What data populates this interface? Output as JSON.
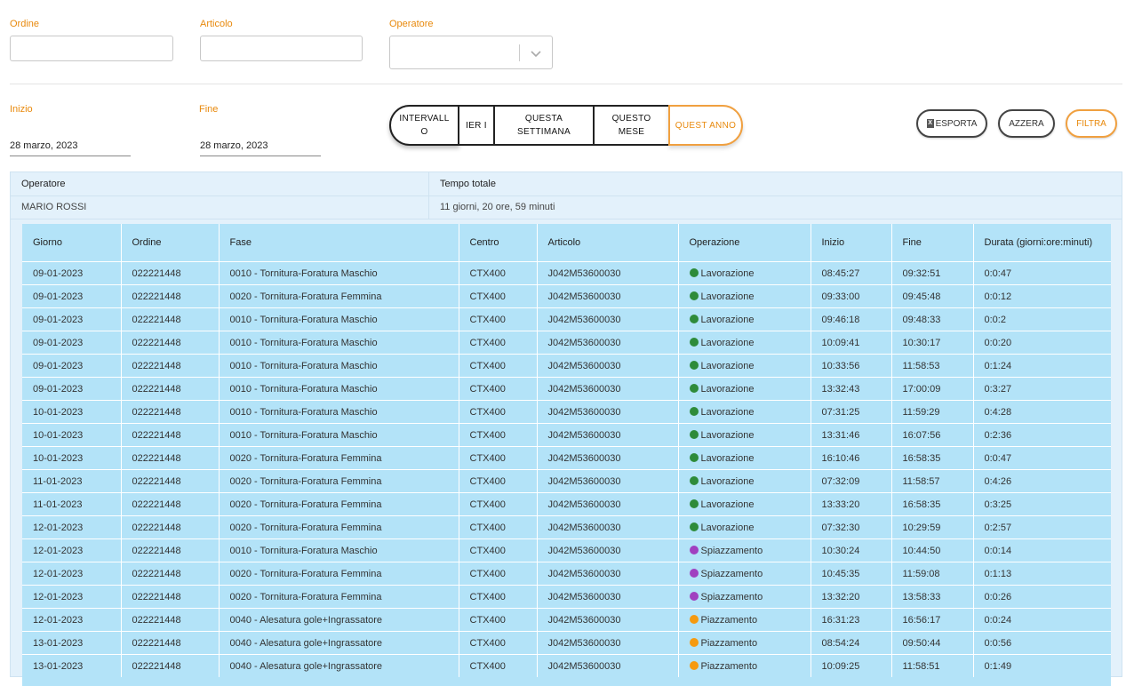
{
  "filters": {
    "ordine_label": "Ordine",
    "articolo_label": "Articolo",
    "operatore_label": "Operatore",
    "inizio_label": "Inizio",
    "inizio_value": "28 marzo, 2023",
    "fine_label": "Fine",
    "fine_value": "28 marzo, 2023"
  },
  "segments": [
    "INTERVALL O",
    "IER I",
    "QUESTA SETTIMANA",
    "QUESTO MESE",
    "QUEST ANNO"
  ],
  "actions": {
    "esporta": "ESPORTA",
    "azzera": "AZZERA",
    "filtra": "FILTRA"
  },
  "summary": {
    "col_operatore": "Operatore",
    "col_tempo": "Tempo totale",
    "operatore": "MARIO ROSSI",
    "tempo": "11 giorni, 20 ore, 59 minuti"
  },
  "colors": {
    "Lavorazione": "#2e8b3a",
    "Spiazzamento": "#a040c0",
    "Piazzamento": "#f59a10",
    "accent": "#e8890c"
  },
  "table": {
    "headers": [
      "Giorno",
      "Ordine",
      "Fase",
      "Centro",
      "Articolo",
      "Operazione",
      "Inizio",
      "Fine",
      "Durata (giorni:ore:minuti)"
    ],
    "rows": [
      [
        "09-01-2023",
        "022221448",
        "0010 - Tornitura-Foratura Maschio",
        "CTX400",
        "J042M53600030",
        "Lavorazione",
        "08:45:27",
        "09:32:51",
        "0:0:47"
      ],
      [
        "09-01-2023",
        "022221448",
        "0020 - Tornitura-Foratura Femmina",
        "CTX400",
        "J042M53600030",
        "Lavorazione",
        "09:33:00",
        "09:45:48",
        "0:0:12"
      ],
      [
        "09-01-2023",
        "022221448",
        "0010 - Tornitura-Foratura Maschio",
        "CTX400",
        "J042M53600030",
        "Lavorazione",
        "09:46:18",
        "09:48:33",
        "0:0:2"
      ],
      [
        "09-01-2023",
        "022221448",
        "0010 - Tornitura-Foratura Maschio",
        "CTX400",
        "J042M53600030",
        "Lavorazione",
        "10:09:41",
        "10:30:17",
        "0:0:20"
      ],
      [
        "09-01-2023",
        "022221448",
        "0010 - Tornitura-Foratura Maschio",
        "CTX400",
        "J042M53600030",
        "Lavorazione",
        "10:33:56",
        "11:58:53",
        "0:1:24"
      ],
      [
        "09-01-2023",
        "022221448",
        "0010 - Tornitura-Foratura Maschio",
        "CTX400",
        "J042M53600030",
        "Lavorazione",
        "13:32:43",
        "17:00:09",
        "0:3:27"
      ],
      [
        "10-01-2023",
        "022221448",
        "0010 - Tornitura-Foratura Maschio",
        "CTX400",
        "J042M53600030",
        "Lavorazione",
        "07:31:25",
        "11:59:29",
        "0:4:28"
      ],
      [
        "10-01-2023",
        "022221448",
        "0010 - Tornitura-Foratura Maschio",
        "CTX400",
        "J042M53600030",
        "Lavorazione",
        "13:31:46",
        "16:07:56",
        "0:2:36"
      ],
      [
        "10-01-2023",
        "022221448",
        "0020 - Tornitura-Foratura Femmina",
        "CTX400",
        "J042M53600030",
        "Lavorazione",
        "16:10:46",
        "16:58:35",
        "0:0:47"
      ],
      [
        "11-01-2023",
        "022221448",
        "0020 - Tornitura-Foratura Femmina",
        "CTX400",
        "J042M53600030",
        "Lavorazione",
        "07:32:09",
        "11:58:57",
        "0:4:26"
      ],
      [
        "11-01-2023",
        "022221448",
        "0020 - Tornitura-Foratura Femmina",
        "CTX400",
        "J042M53600030",
        "Lavorazione",
        "13:33:20",
        "16:58:35",
        "0:3:25"
      ],
      [
        "12-01-2023",
        "022221448",
        "0020 - Tornitura-Foratura Femmina",
        "CTX400",
        "J042M53600030",
        "Lavorazione",
        "07:32:30",
        "10:29:59",
        "0:2:57"
      ],
      [
        "12-01-2023",
        "022221448",
        "0010 - Tornitura-Foratura Maschio",
        "CTX400",
        "J042M53600030",
        "Spiazzamento",
        "10:30:24",
        "10:44:50",
        "0:0:14"
      ],
      [
        "12-01-2023",
        "022221448",
        "0020 - Tornitura-Foratura Femmina",
        "CTX400",
        "J042M53600030",
        "Spiazzamento",
        "10:45:35",
        "11:59:08",
        "0:1:13"
      ],
      [
        "12-01-2023",
        "022221448",
        "0020 - Tornitura-Foratura Femmina",
        "CTX400",
        "J042M53600030",
        "Spiazzamento",
        "13:32:20",
        "13:58:33",
        "0:0:26"
      ],
      [
        "12-01-2023",
        "022221448",
        "0040 - Alesatura gole+Ingrassatore",
        "CTX400",
        "J042M53600030",
        "Piazzamento",
        "16:31:23",
        "16:56:17",
        "0:0:24"
      ],
      [
        "13-01-2023",
        "022221448",
        "0040 - Alesatura gole+Ingrassatore",
        "CTX400",
        "J042M53600030",
        "Piazzamento",
        "08:54:24",
        "09:50:44",
        "0:0:56"
      ],
      [
        "13-01-2023",
        "022221448",
        "0040 - Alesatura gole+Ingrassatore",
        "CTX400",
        "J042M53600030",
        "Piazzamento",
        "10:09:25",
        "11:58:51",
        "0:1:49"
      ]
    ]
  }
}
